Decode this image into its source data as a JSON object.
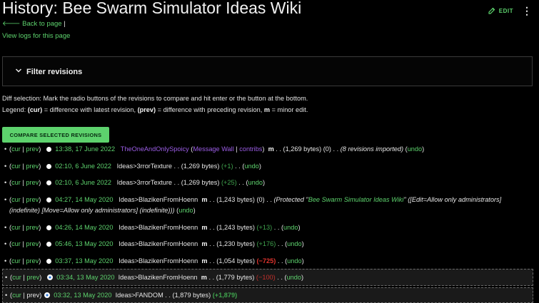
{
  "header": {
    "title": "History: Bee Swarm Simulator Ideas Wiki",
    "edit_label": "EDIT",
    "more_symbol": "⋮"
  },
  "nav": {
    "back_label": "Back to page",
    "separator": "|",
    "view_logs": "View logs for this page"
  },
  "filter": {
    "label": "Filter revisions"
  },
  "help": {
    "diff_selection": "Diff selection: Mark the radio buttons of the revisions to compare and hit enter or the button at the bottom.",
    "legend_prefix": "Legend: ",
    "cur": "(cur)",
    "cur_desc": " = difference with latest revision, ",
    "prev": "(prev)",
    "prev_desc": " = difference with preceding revision, ",
    "m": "m",
    "m_desc": " = minor edit."
  },
  "compare_button": "COMPARE SELECTED REVISIONS",
  "common": {
    "open": "(",
    "cur": "cur",
    "bar": " | ",
    "prev": "prev",
    "close": ")",
    "dots": "‎ . . ",
    "undo": "undo",
    "minor": "m"
  },
  "revisions": [
    {
      "date": "13:38, 17 June 2022",
      "user": "TheOneAndOnlySpoicy",
      "msg_wall": "Message Wall",
      "contribs": "contribs",
      "size": "(1,269 bytes)",
      "diff": "(0)",
      "summary": "(8 revisions imported)"
    },
    {
      "date": "02:10, 6 June 2022",
      "user": "Ideas>3rrorTexture",
      "size": "(1,269 bytes)",
      "diff": "(+1)"
    },
    {
      "date": "02:10, 6 June 2022",
      "user": "Ideas>3rrorTexture",
      "size": "(1,269 bytes)",
      "diff": "(+25)"
    },
    {
      "date": "04:27, 14 May 2020",
      "user": "Ideas>BlazikenFromHoenn",
      "size": "(1,243 bytes)",
      "diff": "(0)",
      "summary_pre": "(Protected \"",
      "summary_link": "Bee Swarm Simulator Ideas Wiki",
      "summary_post": "\" ([Edit=Allow only administrators]",
      "summary_line2": "(indefinite) [Move=Allow only administrators] (indefinite)))"
    },
    {
      "date": "04:26, 14 May 2020",
      "user": "Ideas>BlazikenFromHoenn",
      "size": "(1,243 bytes)",
      "diff": "(+13)"
    },
    {
      "date": "05:46, 13 May 2020",
      "user": "Ideas>BlazikenFromHoenn",
      "size": "(1,230 bytes)",
      "diff": "(+176)"
    },
    {
      "date": "03:37, 13 May 2020",
      "user": "Ideas>BlazikenFromHoenn",
      "size": "(1,054 bytes)",
      "diff": "(−725)"
    },
    {
      "date": "03:34, 13 May 2020",
      "user": "Ideas>BlazikenFromHoenn",
      "size": "(1,779 bytes)",
      "diff": "(−100)"
    },
    {
      "date": "03:32, 13 May 2020",
      "user": "Ideas>FANDOM",
      "size": "(1,879 bytes)",
      "diff": "(+1,879)"
    }
  ],
  "colors": {
    "accent": "#5dd26d",
    "background": "#000000",
    "negative": "#e0342e",
    "radio_selected": "#1e6fd9"
  }
}
